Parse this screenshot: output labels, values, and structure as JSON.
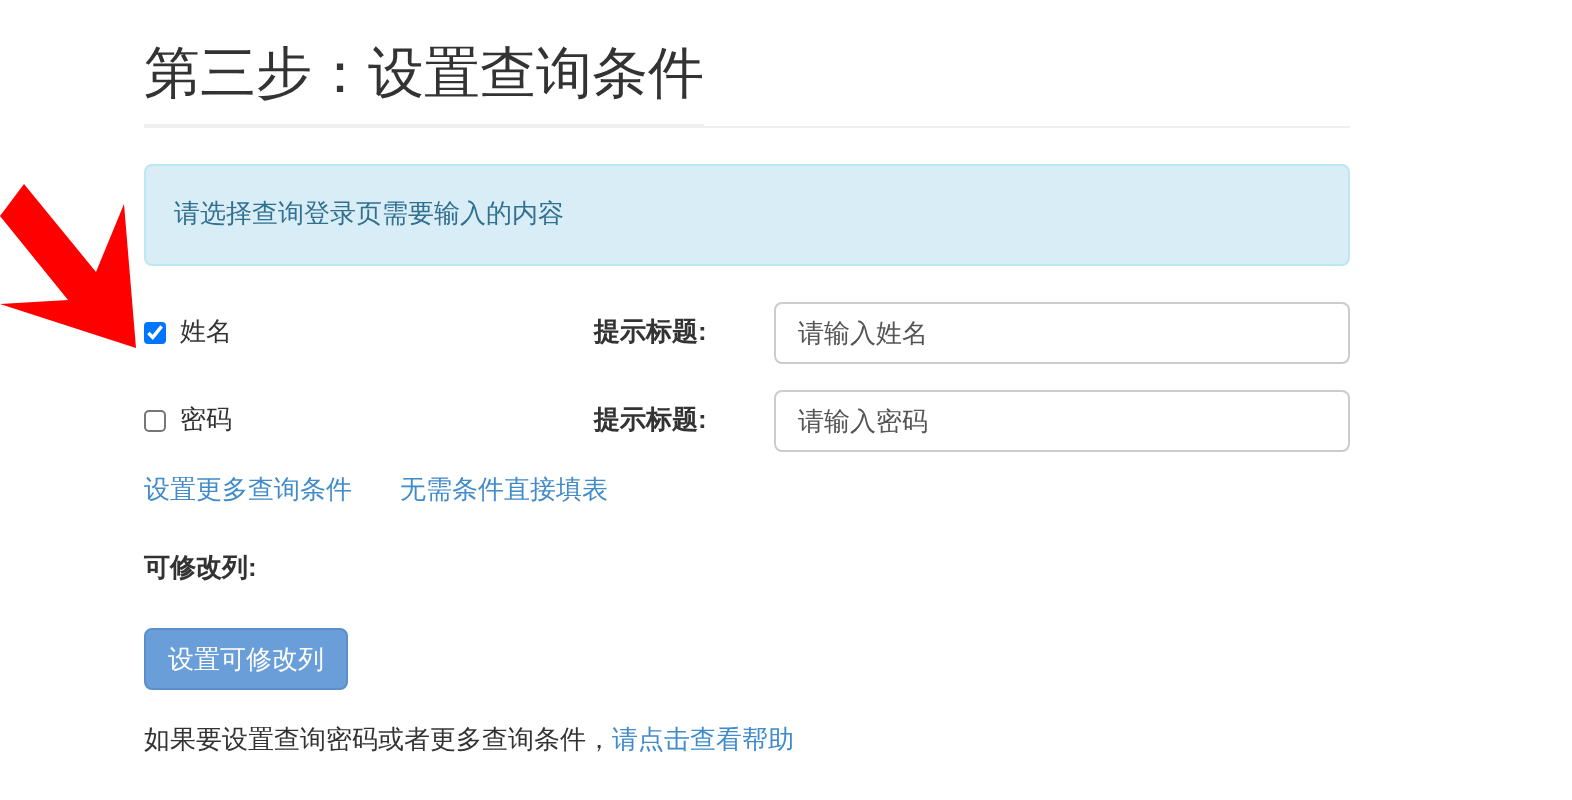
{
  "title": "第三步：设置查询条件",
  "alert": "请选择查询登录页需要输入的内容",
  "conditions": [
    {
      "label": "姓名",
      "checked": true,
      "hint_label": "提示标题:",
      "placeholder": "请输入姓名"
    },
    {
      "label": "密码",
      "checked": false,
      "hint_label": "提示标题:",
      "placeholder": "请输入密码"
    }
  ],
  "links": [
    "设置更多查询条件",
    "无需条件直接填表"
  ],
  "editable_label": "可修改列:",
  "button": "设置可修改列",
  "help": {
    "text": "如果要设置查询密码或者更多查询条件，",
    "link": "请点击查看帮助"
  }
}
